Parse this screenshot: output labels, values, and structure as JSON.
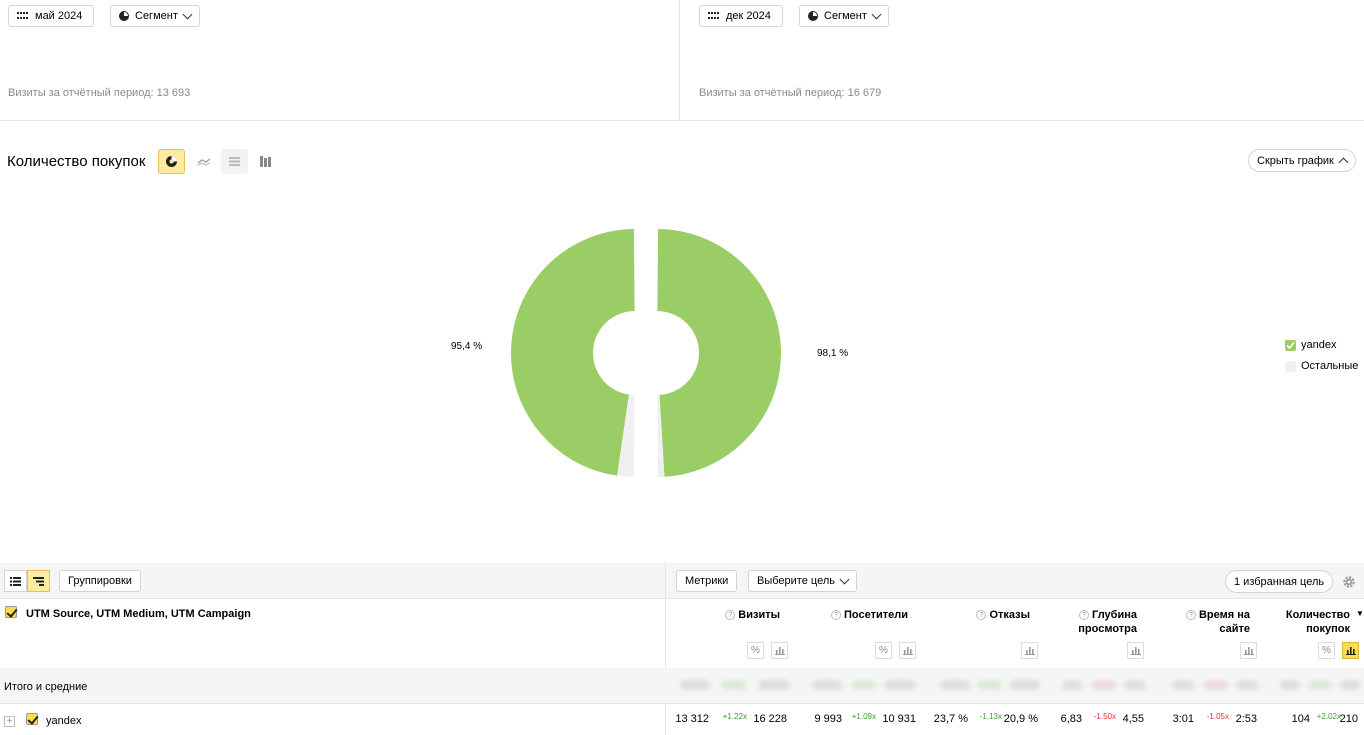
{
  "periods": {
    "left": {
      "date_label": "май 2024",
      "segment_label": "Сегмент",
      "visits_text": "Визиты за отчётный период: 13 693"
    },
    "right": {
      "date_label": "дек 2024",
      "segment_label": "Сегмент",
      "visits_text": "Визиты за отчётный период: 16 679"
    }
  },
  "chart": {
    "title": "Количество покупок",
    "hide_button": "Скрыть график",
    "chart_types": [
      "pie",
      "line",
      "stacked-area",
      "bars"
    ],
    "active_type": "pie",
    "colors": {
      "yandex": "#9acd65",
      "other": "#f0f0f0",
      "accent": "#ffeba0"
    }
  },
  "chart_data": {
    "type": "pie",
    "title": "Количество покупок",
    "series": [
      {
        "label": "95,4 %",
        "values": [
          95.4,
          4.6
        ]
      },
      {
        "label": "98,1 %",
        "values": [
          98.1,
          1.9
        ]
      }
    ],
    "categories": [
      "yandex",
      "Остальные"
    ],
    "legend": "right"
  },
  "legend": [
    {
      "label": "yandex",
      "checked": true
    },
    {
      "label": "Остальные",
      "checked": false
    }
  ],
  "table_toolbar": {
    "groupings": "Группировки",
    "metrics": "Метрики",
    "goal_select": "Выберите цель",
    "favorite_goal": "1 избранная цель"
  },
  "table": {
    "dimension_header": "UTM Source, UTM Medium, UTM Campaign",
    "columns": [
      {
        "line1": "Визиты",
        "line2": ""
      },
      {
        "line1": "Посетители",
        "line2": ""
      },
      {
        "line1": "Отказы",
        "line2": ""
      },
      {
        "line1": "Глубина",
        "line2": "просмотра"
      },
      {
        "line1": "Время на",
        "line2": "сайте"
      },
      {
        "line1": "Количество",
        "line2": "покупок"
      }
    ],
    "totals_label": "Итого и средние",
    "row": {
      "name": "yandex",
      "cells": [
        {
          "a": "13 312",
          "delta": "+1.22x",
          "b": "16 228",
          "dir": "pos"
        },
        {
          "a": "9 993",
          "delta": "+1.09x",
          "b": "10 931",
          "dir": "pos"
        },
        {
          "a": "23,7 %",
          "delta": "-1.13x",
          "b": "20,9 %",
          "dir": "pos"
        },
        {
          "a": "6,83",
          "delta": "-1.50x",
          "b": "4,55",
          "dir": "neg"
        },
        {
          "a": "3:01",
          "delta": "-1.05x",
          "b": "2:53",
          "dir": "neg"
        },
        {
          "a": "104",
          "delta": "+2.02x",
          "b": "210",
          "dir": "pos"
        }
      ]
    }
  }
}
